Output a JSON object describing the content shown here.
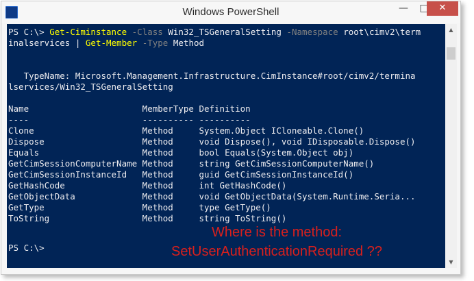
{
  "window": {
    "title": "Windows PowerShell",
    "icon_label": "",
    "icons": {
      "app": "powershell-icon",
      "minimize": "minimize-icon",
      "maximize": "maximize-icon",
      "close": "close-icon"
    },
    "button_glyphs": {
      "minimize": "—",
      "maximize": "□",
      "close": "✕"
    }
  },
  "console": {
    "background": "#012456",
    "prompt1": "PS C:\\> ",
    "cmd_get_ciminstance": "Get-Ciminstance",
    "param_class": "-Class",
    "arg_class": "Win32_TSGeneralSetting",
    "param_namespace": "-Namespace",
    "arg_namespace_part1": "root\\cimv2\\term",
    "arg_namespace_part2": "inalservices",
    "pipe": "|",
    "cmd_get_member": "Get-Member",
    "param_type": "-Type",
    "arg_type": "Method",
    "typename_line1": "   TypeName: Microsoft.Management.Infrastructure.CimInstance#root/cimv2/termina",
    "typename_line2": "lservices/Win32_TSGeneralSetting",
    "header": "Name                      MemberType Definition",
    "separator": "----                      ---------- ----------",
    "rows": [
      "Clone                     Method     System.Object ICloneable.Clone()",
      "Dispose                   Method     void Dispose(), void IDisposable.Dispose()",
      "Equals                    Method     bool Equals(System.Object obj)",
      "GetCimSessionComputerName Method     string GetCimSessionComputerName()",
      "GetCimSessionInstanceId   Method     guid GetCimSessionInstanceId()",
      "GetHashCode               Method     int GetHashCode()",
      "GetObjectData             Method     void GetObjectData(System.Runtime.Seria...",
      "GetType                   Method     type GetType()",
      "ToString                  Method     string ToString()"
    ],
    "prompt2": "PS C:\\>"
  },
  "annotation": {
    "line1": "Where is the method:",
    "line2": "SetUserAuthenticationRequired ??",
    "color": "#d8201d"
  },
  "scrollbar": {
    "up_glyph": "▲",
    "down_glyph": "▼"
  }
}
